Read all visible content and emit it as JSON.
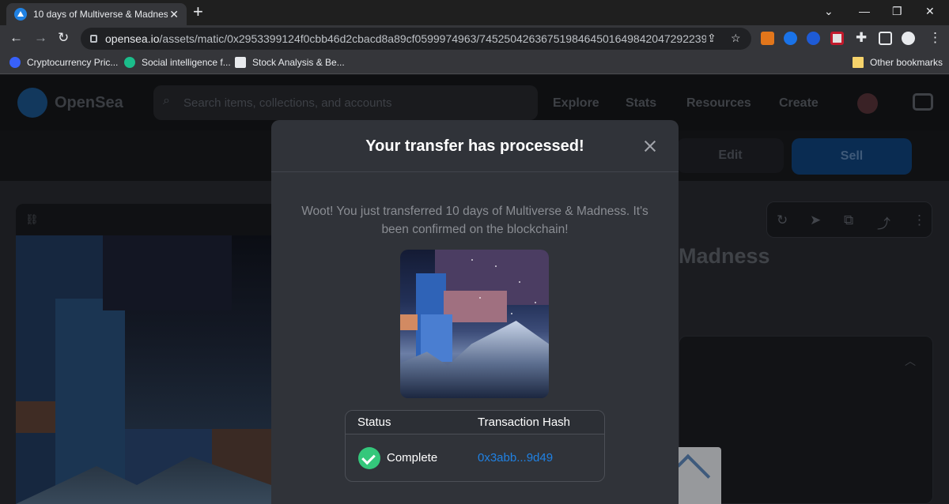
{
  "browser": {
    "tab_title": "10 days of Multiverse & Madness",
    "tab_close": "✕",
    "new_tab": "+",
    "url_host": "opensea.io",
    "url_path": "/assets/matic/0x2953399124f0cbb46d2cbacd8a89cf0599974963/74525042636751984645016498420472922392273...",
    "bookmarks": [
      {
        "label": "Cryptocurrency Pric...",
        "icon": "coinmarketcap-icon",
        "color": "#3861fb"
      },
      {
        "label": "Social intelligence f...",
        "icon": "lunarcrush-icon",
        "color": "#1bbd8b"
      },
      {
        "label": "Stock Analysis & Be...",
        "icon": "stock-analysis-icon",
        "color": "#e8eaed"
      }
    ],
    "other_bookmarks": "Other bookmarks"
  },
  "opensea": {
    "brand": "OpenSea",
    "search_placeholder": "Search items, collections, and accounts",
    "nav": [
      "Explore",
      "Stats",
      "Resources",
      "Create"
    ],
    "edit_label": "Edit",
    "sell_label": "Sell",
    "item_title_fragment": "Madness"
  },
  "modal": {
    "title": "Your transfer has processed!",
    "message": "Woot! You just transferred 10 days of Multiverse & Madness. It's been confirmed on the blockchain!",
    "table": {
      "headers": [
        "Status",
        "Transaction Hash"
      ],
      "status": "Complete",
      "hash": "0x3abb...9d49"
    }
  },
  "colors": {
    "accent": "#2081e2",
    "success": "#34c77b",
    "modal_bg": "#303339"
  }
}
